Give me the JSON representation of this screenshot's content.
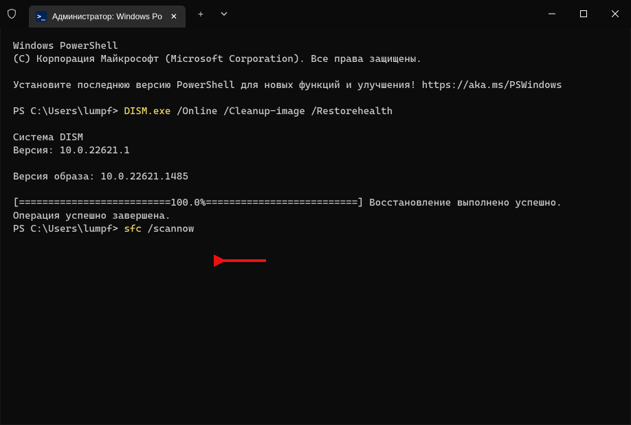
{
  "titlebar": {
    "tab_title": "Администратор: Windows Po",
    "shield_name": "shield-icon",
    "new_tab_label": "+",
    "dropdown_label": "▾",
    "minimize_label": "—",
    "maximize_label": "□",
    "close_label": "✕",
    "tab_close_label": "✕"
  },
  "terminal": {
    "line1": "Windows PowerShell",
    "line2": "(С) Корпорация Майкрософт (Microsoft Corporation). Все права защищены.",
    "blank": "",
    "line3": "Установите последнюю версию PowerShell для новых функций и улучшения! https://aka.ms/PSWindows",
    "prompt1_prefix": "PS C:\\Users\\lumpf> ",
    "prompt1_cmd": "DISM.exe",
    "prompt1_rest": " /Online /Cleanup-image /Restorehealth",
    "dism_header": "Cистема DISM",
    "dism_version": "Версия: 10.0.22621.1",
    "image_version": "Версия образа: 10.0.22621.1485",
    "progress": "[==========================100.0%==========================] Восстановление выполнено успешно.",
    "done": "Операция успешно завершена.",
    "prompt2_prefix": "PS C:\\Users\\lumpf> ",
    "prompt2_cmd": "sfc",
    "prompt2_rest": " /scannow"
  }
}
